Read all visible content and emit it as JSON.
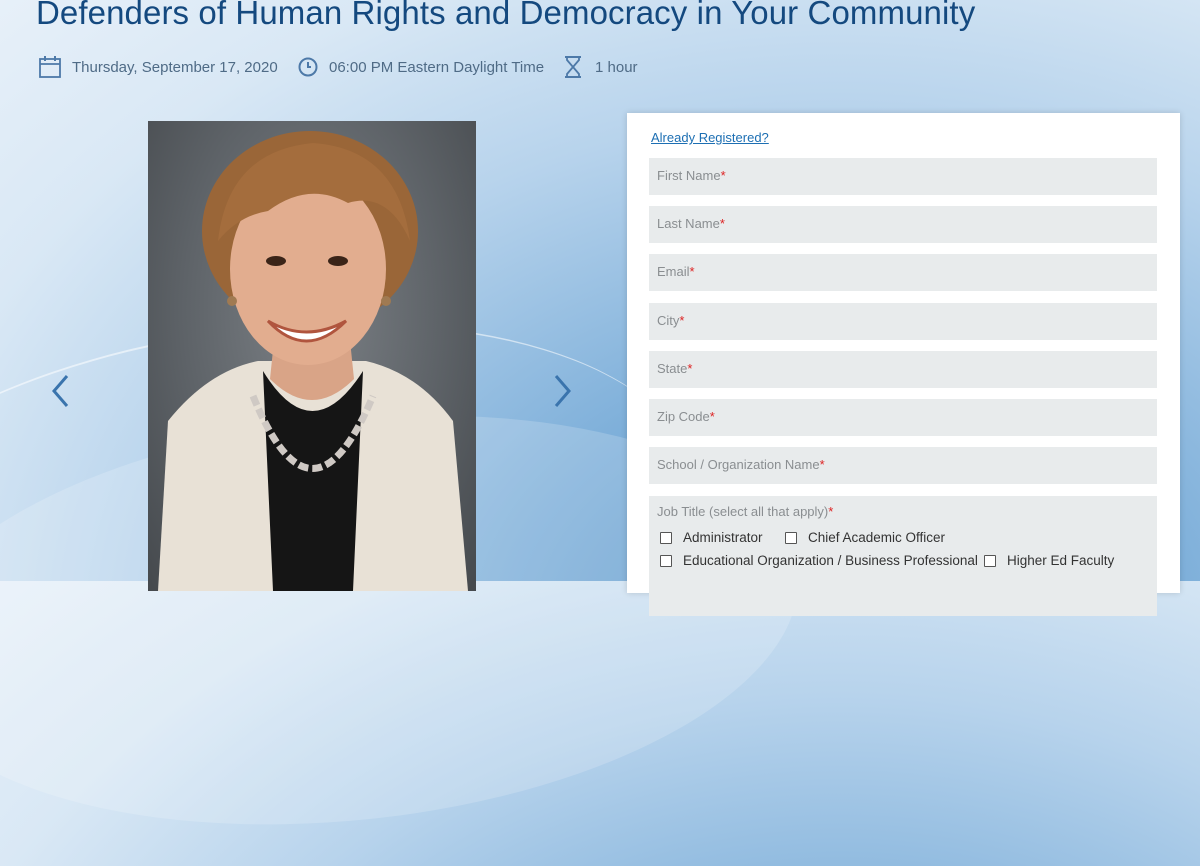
{
  "event": {
    "title": "Defenders of Human Rights and Democracy in Your Community",
    "date": "Thursday, September 17, 2020",
    "time": "06:00 PM Eastern Daylight Time",
    "duration": "1 hour"
  },
  "icons": {
    "date": "calendar-icon",
    "time": "clock-icon",
    "duration": "hourglass-icon",
    "prev": "chevron-left-icon",
    "next": "chevron-right-icon"
  },
  "colors": {
    "title": "#14497f",
    "link": "#1d6fb3",
    "required": "#dd2222"
  },
  "form": {
    "already_registered": "Already Registered?",
    "required_mark": "*",
    "fields": {
      "first_name": "First Name",
      "last_name": "Last Name",
      "email": "Email",
      "city": "City",
      "state": "State",
      "zip": "Zip Code",
      "organization": "School / Organization Name"
    },
    "job_title": {
      "label": "Job Title (select all that apply)",
      "options": {
        "administrator": "Administrator",
        "chief_academic_officer": "Chief Academic Officer",
        "educational_org": "Educational Organization / Business Professional",
        "higher_ed": "Higher Ed Faculty"
      }
    }
  }
}
